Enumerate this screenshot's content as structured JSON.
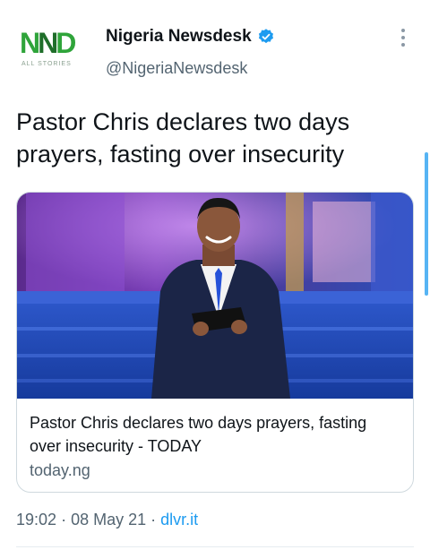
{
  "account": {
    "logo_text_a": "N",
    "logo_text_b": "N",
    "logo_text_c": "D",
    "logo_subtitle": "ALL STORIES",
    "display_name": "Nigeria Newsdesk",
    "handle": "@NigeriaNewsdesk",
    "verified": true,
    "verified_color": "#1d9bf0"
  },
  "tweet": {
    "text": "Pastor Chris declares two days prayers, fasting over insecurity"
  },
  "card": {
    "image_icon": "photo-of-speaker-on-stage",
    "title": "Pastor Chris declares two days prayers, fasting over insecurity - TODAY",
    "domain": "today.ng"
  },
  "meta": {
    "time": "19:02",
    "separator": "·",
    "date": "08 May 21",
    "source": "dlvr.it"
  },
  "colors": {
    "accent": "#1d9bf0",
    "secondary_text": "#536471",
    "border": "#cfd9de"
  }
}
